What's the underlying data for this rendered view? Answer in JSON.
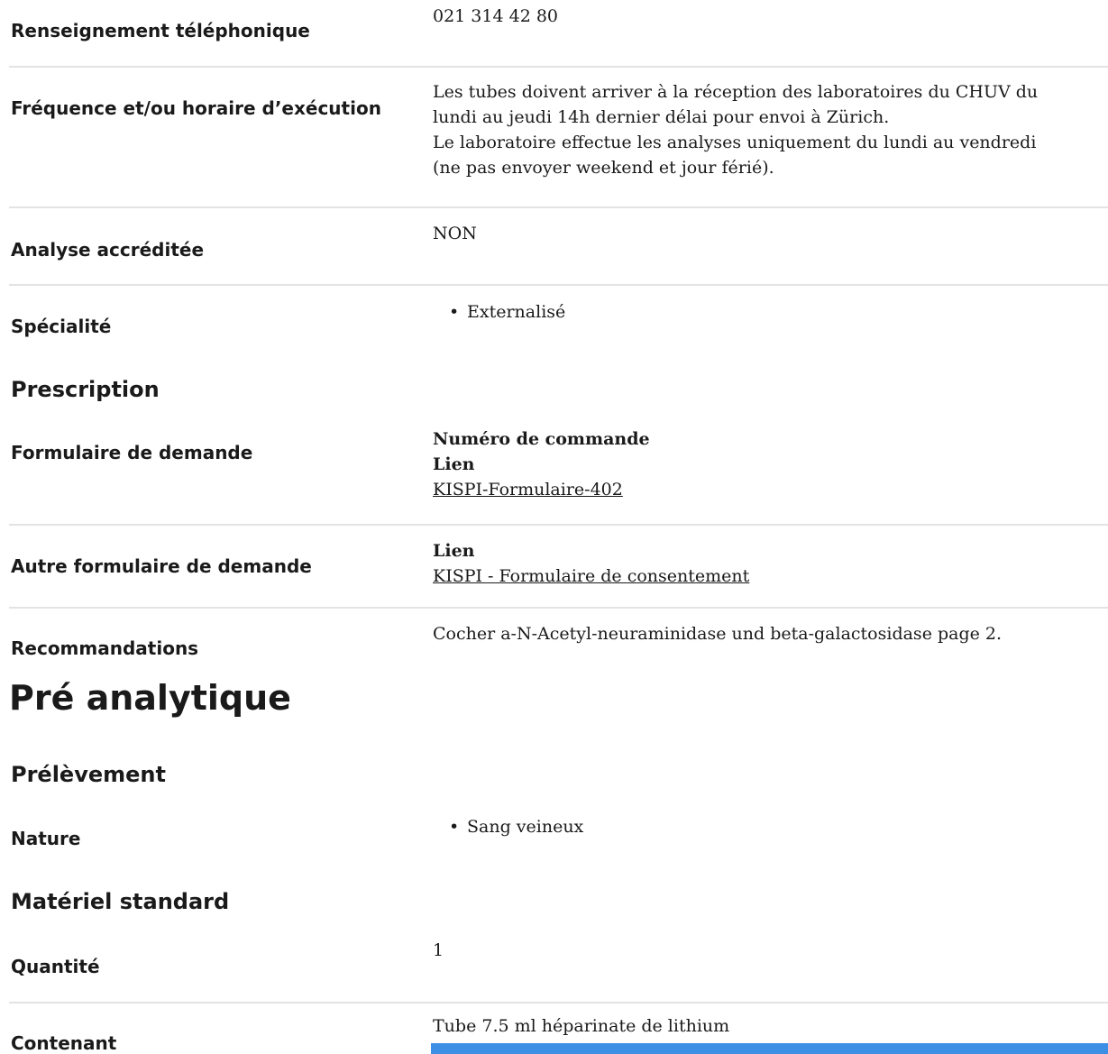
{
  "fields": {
    "phone": {
      "label": "Renseignement téléphonique",
      "value": "021 314 42 80"
    },
    "frequency": {
      "label": "Fréquence et/ou horaire d’exécution",
      "lines": [
        "Les tubes doivent arriver à la réception des laboratoires du CHUV du",
        "lundi au jeudi 14h dernier délai pour envoi à Zürich.",
        "Le laboratoire effectue les analyses uniquement du lundi au vendredi",
        "(ne pas envoyer weekend et jour férié)."
      ]
    },
    "accredited": {
      "label": "Analyse accréditée",
      "value": "NON"
    },
    "specialty": {
      "label": "Spécialité",
      "items": [
        "Externalisé"
      ]
    }
  },
  "prescription": {
    "heading": "Prescription",
    "form": {
      "label": "Formulaire de demande",
      "order_label": "Numéro de commande",
      "link_label": "Lien",
      "link_text": "KISPI-Formulaire-402"
    },
    "other_form": {
      "label": "Autre formulaire de demande",
      "link_label": "Lien",
      "link_text": "KISPI - Formulaire de consentement"
    },
    "recommendations": {
      "label": "Recommandations",
      "value": "Cocher a-N-Acetyl-neuraminidase und beta-galactosidase page 2."
    }
  },
  "pre_analytic": {
    "heading": "Pré analytique",
    "sampling": {
      "heading": "Prélèvement",
      "nature": {
        "label": "Nature",
        "items": [
          "Sang veineux"
        ]
      }
    },
    "material": {
      "heading": "Matériel standard",
      "quantity": {
        "label": "Quantité",
        "value": "1"
      },
      "container": {
        "label": "Contenant",
        "value": "Tube 7.5 ml héparinate de lithium"
      }
    }
  },
  "colors": {
    "accent_bar": "#3d8ee5",
    "divider": "#e3e3e3"
  }
}
